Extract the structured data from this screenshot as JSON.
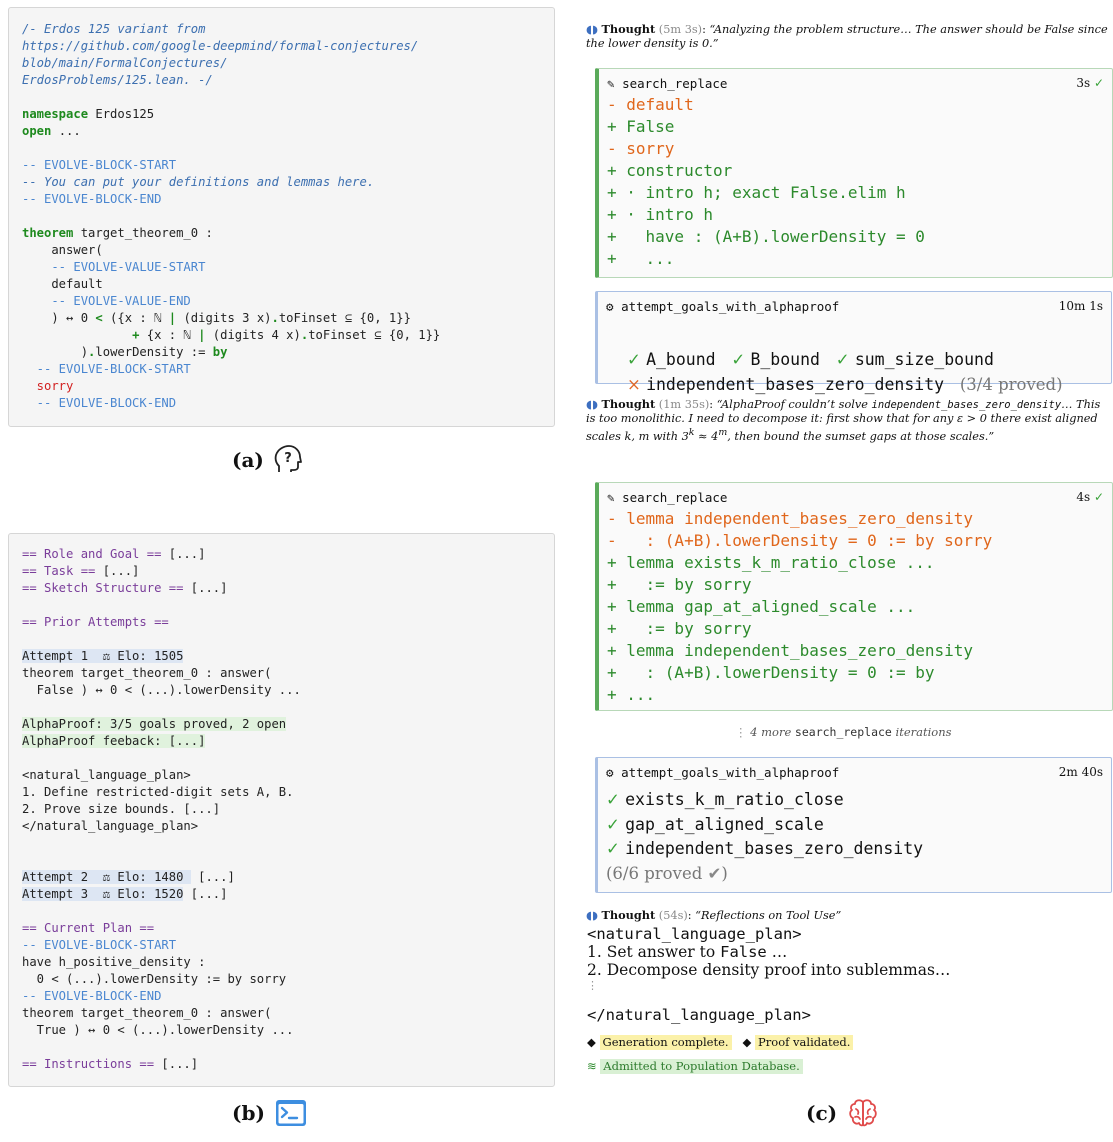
{
  "panel_a": {
    "lines": [
      [
        {
          "t": "/- Erdos 125 variant from",
          "c": "k-comment"
        }
      ],
      [
        {
          "t": "https://github.com/google-deepmind/formal-conjectures/",
          "c": "k-comment"
        }
      ],
      [
        {
          "t": "blob/main/FormalConjectures/",
          "c": "k-comment"
        }
      ],
      [
        {
          "t": "ErdosProblems/125.lean. -/",
          "c": "k-comment"
        }
      ],
      [
        {
          "t": "",
          "c": ""
        }
      ],
      [
        {
          "t": "namespace",
          "c": "k-green"
        },
        {
          "t": " Erdos125",
          "c": ""
        }
      ],
      [
        {
          "t": "open",
          "c": "k-green"
        },
        {
          "t": " ...",
          "c": ""
        }
      ],
      [
        {
          "t": "",
          "c": ""
        }
      ],
      [
        {
          "t": "-- EVOLVE-BLOCK-START",
          "c": "k-blue"
        }
      ],
      [
        {
          "t": "-- You can put your definitions and lemmas here.",
          "c": "k-comment"
        }
      ],
      [
        {
          "t": "-- EVOLVE-BLOCK-END",
          "c": "k-blue"
        }
      ],
      [
        {
          "t": "",
          "c": ""
        }
      ],
      [
        {
          "t": "theorem",
          "c": "k-green"
        },
        {
          "t": " target_theorem_0 :",
          "c": ""
        }
      ],
      [
        {
          "t": "    answer(",
          "c": ""
        }
      ],
      [
        {
          "t": "    -- EVOLVE-VALUE-START",
          "c": "k-blue"
        }
      ],
      [
        {
          "t": "    default",
          "c": ""
        }
      ],
      [
        {
          "t": "    -- EVOLVE-VALUE-END",
          "c": "k-blue"
        }
      ],
      [
        {
          "t": "    ) ↔ 0 ",
          "c": ""
        },
        {
          "t": "<",
          "c": "k-green"
        },
        {
          "t": " ({x : ℕ ",
          "c": ""
        },
        {
          "t": "|",
          "c": "k-green"
        },
        {
          "t": " (digits 3 x)",
          "c": ""
        },
        {
          "t": ".",
          "c": "k-green"
        },
        {
          "t": "toFinset ⊆ {0, 1}}",
          "c": ""
        }
      ],
      [
        {
          "t": "               ",
          "c": ""
        },
        {
          "t": "+",
          "c": "k-green"
        },
        {
          "t": " {x : ℕ ",
          "c": ""
        },
        {
          "t": "|",
          "c": "k-green"
        },
        {
          "t": " (digits 4 x)",
          "c": ""
        },
        {
          "t": ".",
          "c": "k-green"
        },
        {
          "t": "toFinset ⊆ {0, 1}}",
          "c": ""
        }
      ],
      [
        {
          "t": "        )",
          "c": ""
        },
        {
          "t": ".",
          "c": "k-green"
        },
        {
          "t": "lowerDensity := ",
          "c": ""
        },
        {
          "t": "by",
          "c": "k-green"
        }
      ],
      [
        {
          "t": "  -- EVOLVE-BLOCK-START",
          "c": "k-blue"
        }
      ],
      [
        {
          "t": "  sorry",
          "c": "k-red"
        }
      ],
      [
        {
          "t": "  -- EVOLVE-BLOCK-END",
          "c": "k-blue"
        }
      ]
    ]
  },
  "panel_b": {
    "lines": [
      [
        {
          "t": "== Role and Goal ==",
          "c": "k-purple"
        },
        {
          "t": " [...]",
          "c": ""
        }
      ],
      [
        {
          "t": "== Task ==",
          "c": "k-purple"
        },
        {
          "t": " [...]",
          "c": ""
        }
      ],
      [
        {
          "t": "== Sketch Structure ==",
          "c": "k-purple"
        },
        {
          "t": " [...]",
          "c": ""
        }
      ],
      [
        {
          "t": "",
          "c": ""
        }
      ],
      [
        {
          "t": "== Prior Attempts ==",
          "c": "k-purple"
        }
      ],
      [
        {
          "t": "",
          "c": ""
        }
      ],
      [
        {
          "t": "Attempt 1  ⚖ Elo: 1505",
          "c": "hl-blue"
        }
      ],
      [
        {
          "t": "theorem target_theorem_0 : answer(",
          "c": ""
        }
      ],
      [
        {
          "t": "  False ) ↔ 0 < (...).lowerDensity ...",
          "c": ""
        }
      ],
      [
        {
          "t": "",
          "c": ""
        }
      ],
      [
        {
          "t": "AlphaProof: 3/5 goals proved, 2 open",
          "c": "hl-green"
        }
      ],
      [
        {
          "t": "AlphaProof feeback: [...]",
          "c": "hl-green"
        }
      ],
      [
        {
          "t": "",
          "c": ""
        }
      ],
      [
        {
          "t": "<natural_language_plan>",
          "c": ""
        }
      ],
      [
        {
          "t": "1. Define restricted-digit sets A, B.",
          "c": ""
        }
      ],
      [
        {
          "t": "2. Prove size bounds. [...]",
          "c": ""
        }
      ],
      [
        {
          "t": "</natural_language_plan>",
          "c": ""
        }
      ],
      [
        {
          "t": "",
          "c": ""
        }
      ],
      [
        {
          "t": "",
          "c": ""
        }
      ],
      [
        {
          "t": "Attempt 2  ⚖ Elo: 1480 ",
          "c": "hl-blue"
        },
        {
          "t": " [...]",
          "c": ""
        }
      ],
      [
        {
          "t": "Attempt 3  ⚖ Elo: 1520",
          "c": "hl-blue"
        },
        {
          "t": " [...]",
          "c": ""
        }
      ],
      [
        {
          "t": "",
          "c": ""
        }
      ],
      [
        {
          "t": "== Current Plan ==",
          "c": "k-purple"
        }
      ],
      [
        {
          "t": "-- EVOLVE-BLOCK-START",
          "c": "k-blue"
        }
      ],
      [
        {
          "t": "have h_positive_density :",
          "c": ""
        }
      ],
      [
        {
          "t": "  0 < (...).lowerDensity := by sorry",
          "c": ""
        }
      ],
      [
        {
          "t": "-- EVOLVE-BLOCK-END",
          "c": "k-blue"
        }
      ],
      [
        {
          "t": "theorem target_theorem_0 : answer(",
          "c": ""
        }
      ],
      [
        {
          "t": "  True ) ↔ 0 < (...).lowerDensity ...",
          "c": ""
        }
      ],
      [
        {
          "t": "",
          "c": ""
        }
      ],
      [
        {
          "t": "== Instructions ==",
          "c": "k-purple"
        },
        {
          "t": " [...]",
          "c": ""
        }
      ]
    ]
  },
  "captions": {
    "a": "(a)",
    "b": "(b)",
    "c": "(c)",
    "a_icon": "head-question-icon",
    "b_icon": "terminal-icon",
    "c_icon": "brain-icon"
  },
  "right": {
    "thought1": {
      "label": "Thought",
      "time": "(5m 3s)",
      "quote": "“Analyzing the problem structure… The answer should be False since the lower density is 0.”"
    },
    "sr1": {
      "tool": "search_replace",
      "time": "3s",
      "lines": [
        {
          "t": "- default",
          "c": "del"
        },
        {
          "t": "+ False",
          "c": "add"
        },
        {
          "t": "- sorry",
          "c": "del"
        },
        {
          "t": "+ constructor",
          "c": "add"
        },
        {
          "t": "+ · intro h; exact False.elim h",
          "c": "add"
        },
        {
          "t": "+ · intro h",
          "c": "add"
        },
        {
          "t": "+   have : (A+B).lowerDensity = 0",
          "c": "add"
        },
        {
          "t": "+   ...",
          "c": "add"
        }
      ]
    },
    "ap1": {
      "tool": "attempt_goals_with_alphaproof",
      "time": "10m 1s",
      "row1": [
        "A_bound",
        "B_bound",
        "sum_size_bound"
      ],
      "failed": "independent_bases_zero_density",
      "summary": "(3/4 proved)"
    },
    "thought2": {
      "label": "Thought",
      "time": "(1m 35s)",
      "quote_a": "“AlphaProof couldn’t solve ",
      "code": "independent_bases_zero_density",
      "quote_b": "… This is too monolithic. I need to decompose it: first show that for any ε > 0 there exist aligned scales k, m with 3",
      "sup_k": "k",
      "approx": " ≈ 4",
      "sup_m": "m",
      "quote_c": ", then bound the sumset gaps at those scales.”"
    },
    "sr2": {
      "tool": "search_replace",
      "time": "4s",
      "lines": [
        {
          "t": "- lemma independent_bases_zero_density",
          "c": "del"
        },
        {
          "t": "-   : (A+B).lowerDensity = 0 := by sorry",
          "c": "del"
        },
        {
          "t": "+ lemma exists_k_m_ratio_close ...",
          "c": "add"
        },
        {
          "t": "+   := by sorry",
          "c": "add"
        },
        {
          "t": "+ lemma gap_at_aligned_scale ...",
          "c": "add"
        },
        {
          "t": "+   := by sorry",
          "c": "add"
        },
        {
          "t": "+ lemma independent_bases_zero_density",
          "c": "add"
        },
        {
          "t": "+   : (A+B).lowerDensity = 0 := by",
          "c": "add"
        },
        {
          "t": "+ ...",
          "c": "add"
        }
      ]
    },
    "iter": {
      "a": "4 more ",
      "code": "search_replace",
      "b": " iterations"
    },
    "ap2": {
      "tool": "attempt_goals_with_alphaproof",
      "time": "2m 40s",
      "goals": [
        "exists_k_m_ratio_close",
        "gap_at_aligned_scale",
        "independent_bases_zero_density"
      ],
      "summary": "(6/6 proved"
    },
    "thought3": {
      "label": "Thought",
      "time": "(54s)",
      "quote": "“Reflections on Tool Use”"
    },
    "plan": {
      "open": "<natural_language_plan>",
      "l1a": "1. Set answer to ",
      "l1code": "False",
      "l1b": " …",
      "l2": "2. Decompose density proof into sublemmas…",
      "close": "</natural_language_plan>"
    },
    "badges": {
      "gen": "Generation complete.",
      "proof": "Proof validated.",
      "db": "Admitted to Population Database."
    },
    "colors": {
      "check": "#3aa33a",
      "cross": "#e06a2a",
      "del": "#e0661b",
      "add": "#2c8a2c",
      "accent_blue": "#3d6fc0"
    }
  }
}
